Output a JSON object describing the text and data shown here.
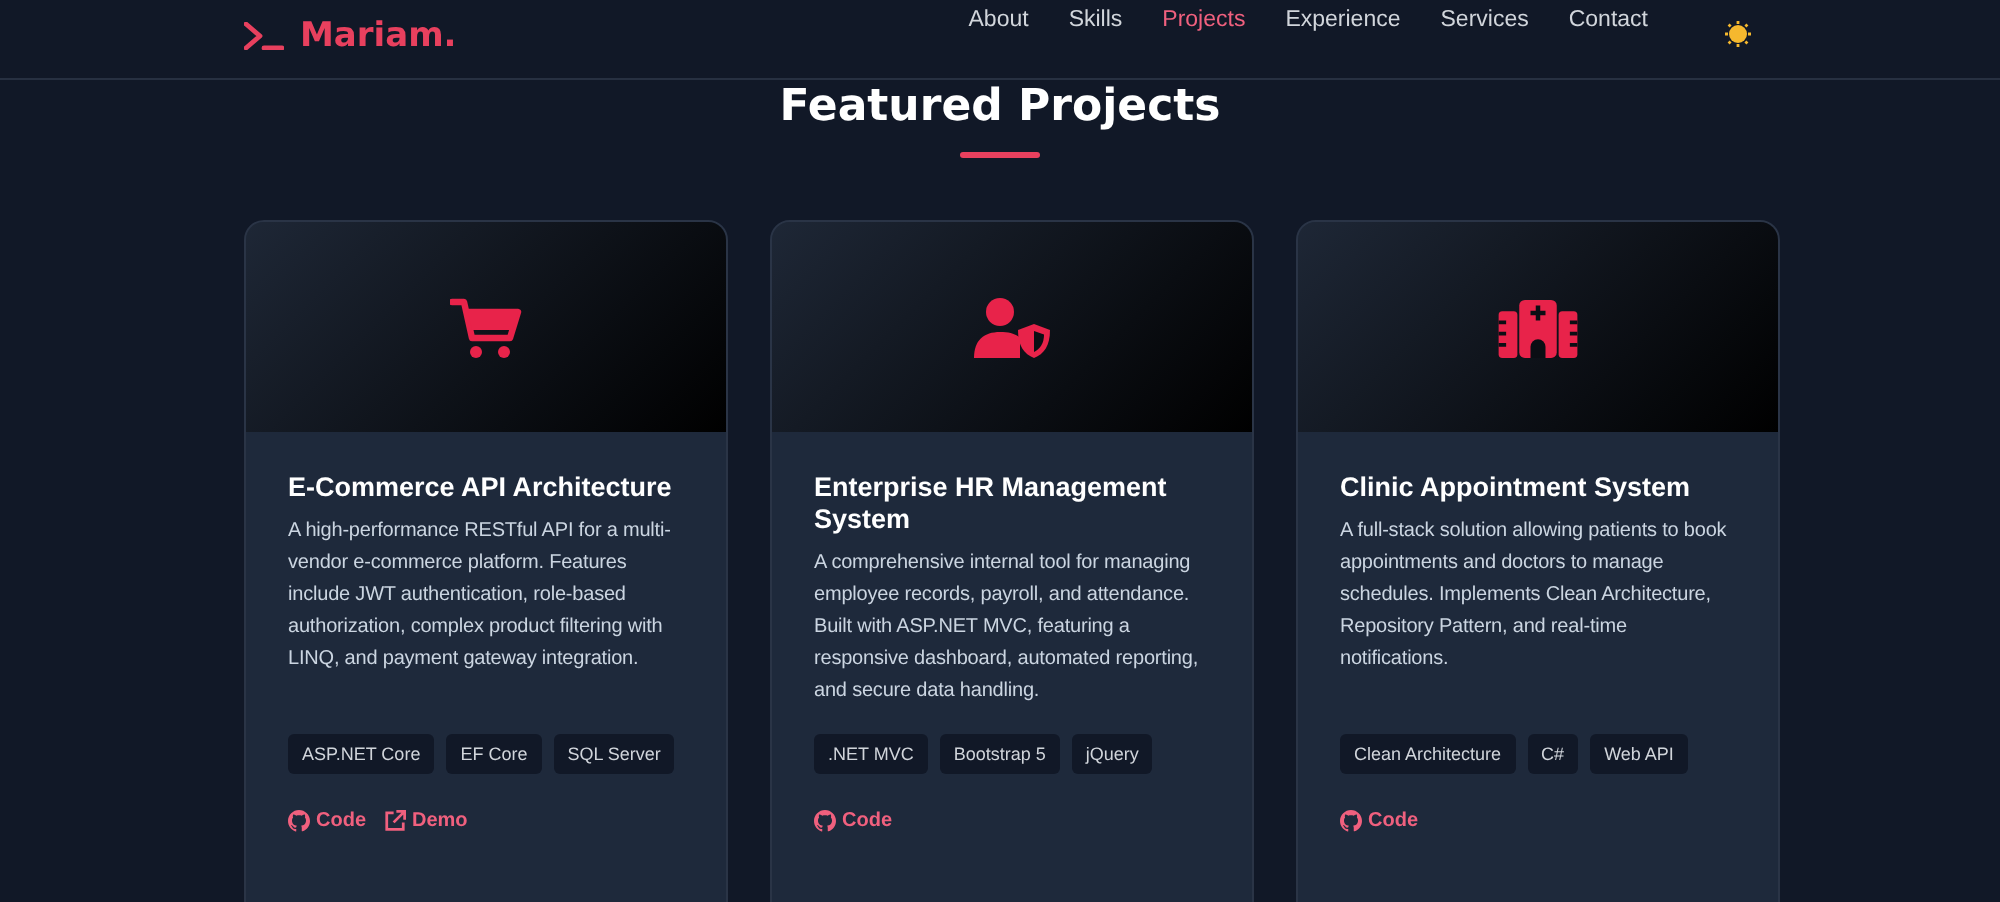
{
  "logo": {
    "text": "Mariam."
  },
  "nav": [
    {
      "label": "About",
      "selected": false
    },
    {
      "label": "Skills",
      "selected": false
    },
    {
      "label": "Projects",
      "selected": true
    },
    {
      "label": "Experience",
      "selected": false
    },
    {
      "label": "Services",
      "selected": false
    },
    {
      "label": "Contact",
      "selected": false
    }
  ],
  "section_title": "Featured Projects",
  "projects": [
    {
      "kind": "cart",
      "title": "E-Commerce API Architecture",
      "description": "A high-performance RESTful API for a multi-vendor e-commerce platform. Features include JWT authentication, role-based authorization, complex product filtering with LINQ, and payment gateway integration.",
      "tags": [
        "ASP.NET Core",
        "EF Core",
        "SQL Server"
      ],
      "links": [
        {
          "kind": "code",
          "label": "Code"
        },
        {
          "kind": "demo",
          "label": "Demo"
        }
      ]
    },
    {
      "kind": "user-shield",
      "title": "Enterprise HR Management System",
      "description": "A comprehensive internal tool for managing employee records, payroll, and attendance. Built with ASP.NET MVC, featuring a responsive dashboard, automated reporting, and secure data handling.",
      "tags": [
        ".NET MVC",
        "Bootstrap 5",
        "jQuery"
      ],
      "links": [
        {
          "kind": "code",
          "label": "Code"
        }
      ]
    },
    {
      "kind": "hospital",
      "title": "Clinic Appointment System",
      "description": "A full-stack solution allowing patients to book appointments and doctors to manage schedules. Implements Clean Architecture, Repository Pattern, and real-time notifications.",
      "tags": [
        "Clean Architecture",
        "C#",
        "Web API"
      ],
      "links": [
        {
          "kind": "code",
          "label": "Code"
        }
      ]
    }
  ]
}
